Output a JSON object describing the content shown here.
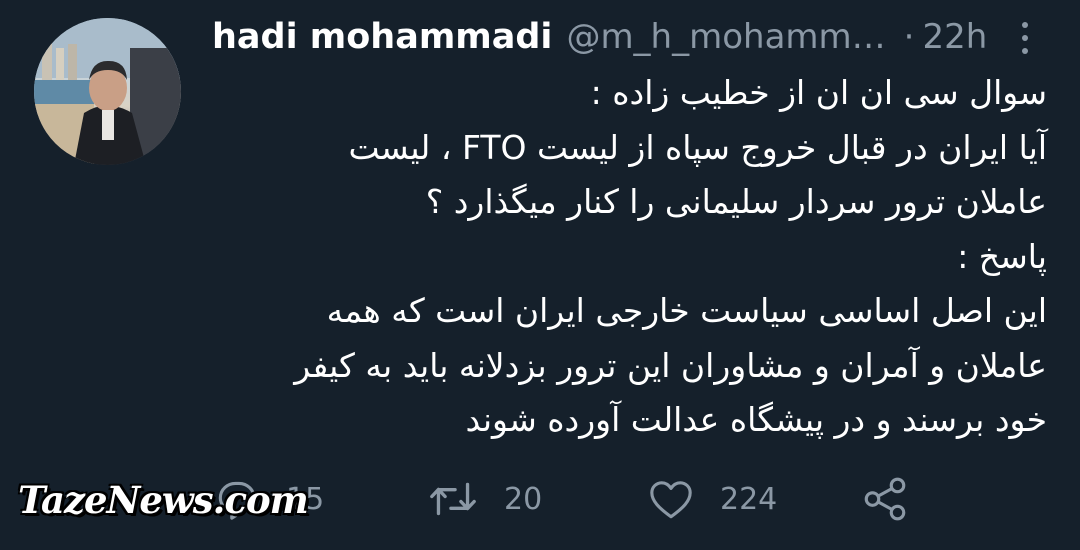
{
  "tweet": {
    "author_name": "hadi mohammadi",
    "handle": "@m_h_mohamm…",
    "separator": "·",
    "time": "22h",
    "lines": [
      "سوال سی ان ان از خطیب زاده :",
      "آیا ایران در قبال خروج سپاه از لیست FTO ، لیست",
      "عاملان ترور سردار سلیمانی را کنار میگذارد ؟",
      "پاسخ :",
      "این اصل اساسی سیاست خارجی ایران است که همه",
      "عاملان و آمران و مشاوران این ترور بزدلانه باید به کیفر",
      "خود برسند و در پیشگاه عدالت آورده شوند"
    ]
  },
  "actions": {
    "reply_count": "15",
    "retweet_count": "20",
    "like_count": "224"
  },
  "watermark": "TazeNews.com",
  "icons": [
    "more-icon",
    "reply-icon",
    "retweet-icon",
    "like-icon",
    "share-icon"
  ],
  "colors": {
    "background": "#15202b",
    "text": "#ffffff",
    "secondary": "#8b98a5"
  }
}
